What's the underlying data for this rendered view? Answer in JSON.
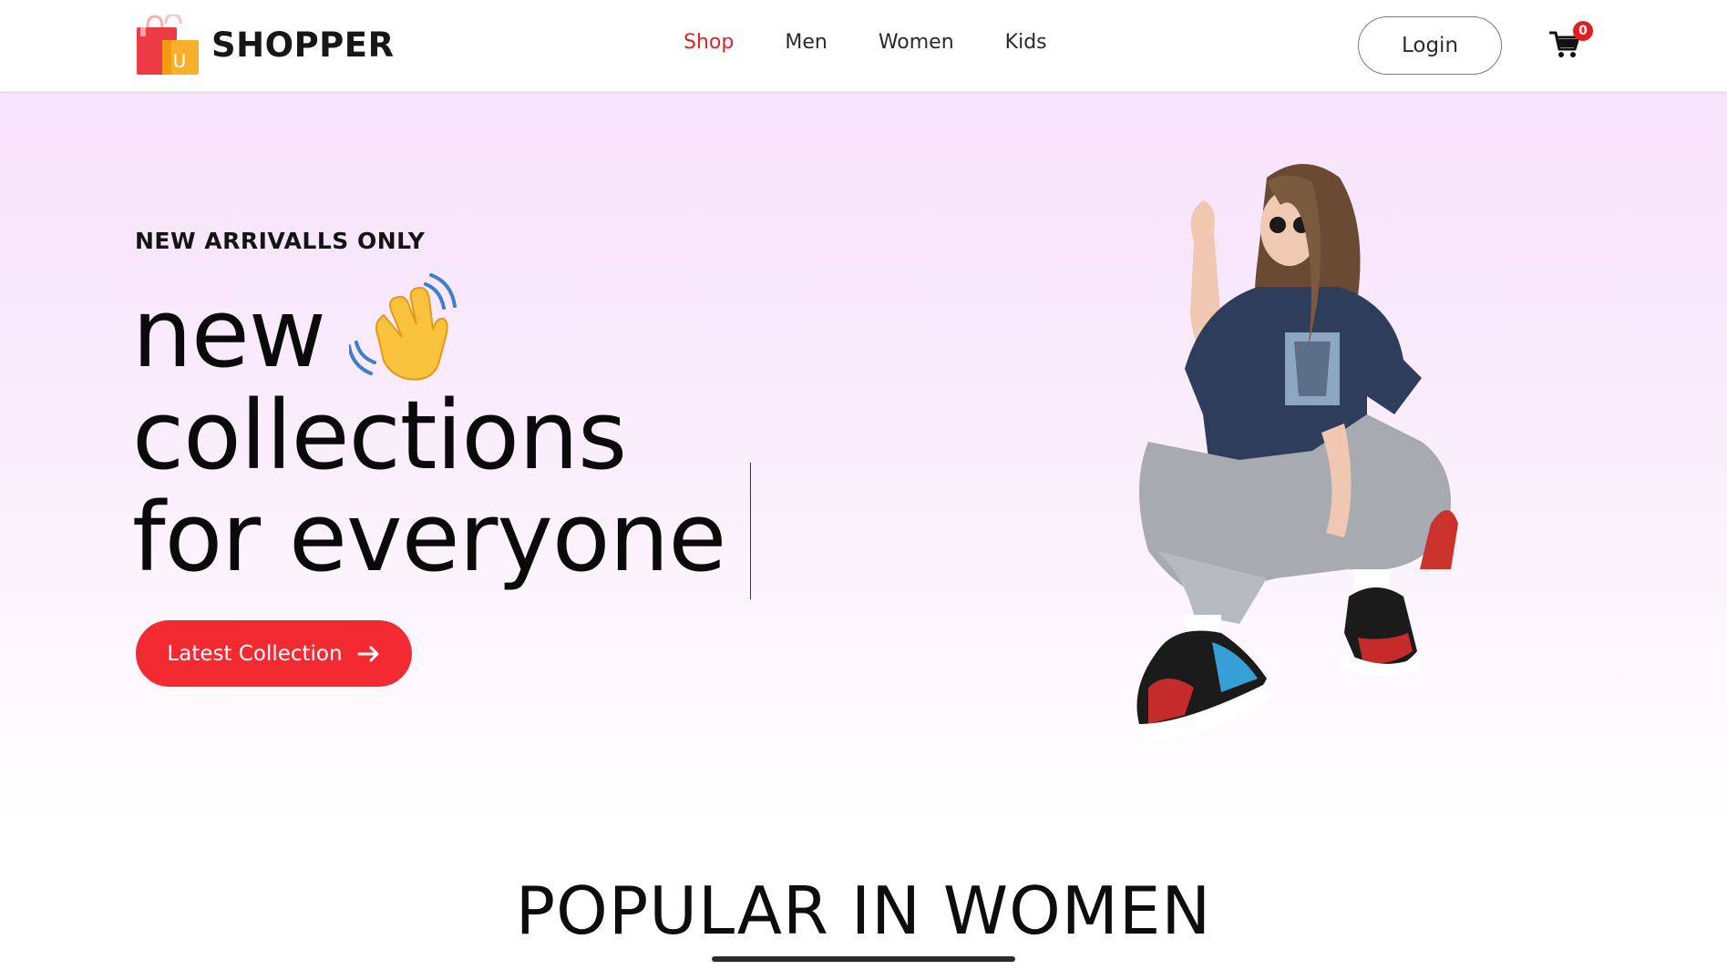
{
  "navbar": {
    "brand": {
      "name": "SHOPPER",
      "logo_letter": "U",
      "logo_icon": "shopping-bags-icon"
    },
    "menu": [
      {
        "label": "Shop",
        "active": true
      },
      {
        "label": "Men",
        "active": false
      },
      {
        "label": "Women",
        "active": false
      },
      {
        "label": "Kids",
        "active": false
      }
    ],
    "login_label": "Login",
    "cart": {
      "icon": "cart-icon",
      "count": "0"
    }
  },
  "hero": {
    "eyebrow": "NEW ARRIVALLS ONLY",
    "headline": [
      "new",
      "collections",
      "for everyone"
    ],
    "headline_icon": "waving-hand-icon",
    "cta_label": "Latest Collection",
    "cta_icon": "arrow-right-icon",
    "image_icon": "hero-model-image"
  },
  "popular": {
    "title": "POPULAR IN WOMEN"
  },
  "colors": {
    "accent": "#e0242b",
    "cta": "#f42a33",
    "hero_top": "#f7e1fb",
    "hero_bottom": "#ffffff",
    "text": "#0b0b0b"
  }
}
